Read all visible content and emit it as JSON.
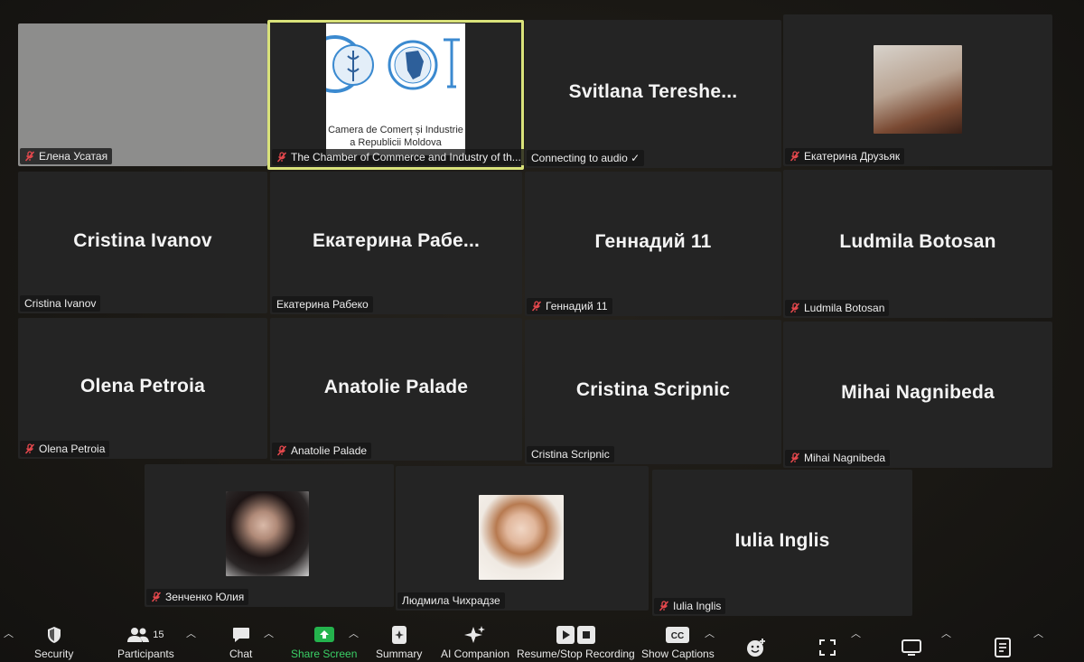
{
  "tiles": [
    {
      "id": "t1",
      "label": "Елена Усатая",
      "muted": true
    },
    {
      "id": "t2",
      "label": "The Chamber of Commerce and Industry of th...",
      "muted": true,
      "logo_text_1": "Camera de Comerț și Industrie",
      "logo_text_2": "a Republicii Moldova"
    },
    {
      "id": "t3",
      "center": "Svitlana  Tereshe...",
      "label": "Connecting to audio ✓",
      "muted": false
    },
    {
      "id": "t4",
      "label": "Екатерина Друзьяк",
      "muted": true
    },
    {
      "id": "t5",
      "center": "Cristina Ivanov",
      "label": "Cristina Ivanov",
      "muted": false
    },
    {
      "id": "t6",
      "center": "Екатерина  Рабе...",
      "label": "Екатерина Рабеко",
      "muted": false
    },
    {
      "id": "t7",
      "center": "Геннадий 11",
      "label": "Геннадий 11",
      "muted": true
    },
    {
      "id": "t8",
      "center": "Ludmila Botosan",
      "label": "Ludmila Botosan",
      "muted": true
    },
    {
      "id": "t9",
      "center": "Olena Petroia",
      "label": "Olena Petroia",
      "muted": true
    },
    {
      "id": "t10",
      "center": "Anatolie Palade",
      "label": "Anatolie Palade",
      "muted": true
    },
    {
      "id": "t11",
      "center": "Cristina Scripnic",
      "label": "Cristina Scripnic",
      "muted": false
    },
    {
      "id": "t12",
      "center": "Mihai Nagnibeda",
      "label": "Mihai Nagnibeda",
      "muted": true
    },
    {
      "id": "t13",
      "label": "Зенченко Юлия",
      "muted": true
    },
    {
      "id": "t14",
      "label": "Людмила Чихрадзе",
      "muted": false
    },
    {
      "id": "t15",
      "center": "Iulia Inglis",
      "label": "Iulia Inglis",
      "muted": true
    }
  ],
  "toolbar": {
    "security": "Security",
    "participants": "Participants",
    "participants_count": "15",
    "chat": "Chat",
    "share_screen": "Share Screen",
    "summary": "Summary",
    "ai_companion": "AI Companion",
    "recording": "Resume/Stop Recording",
    "captions": "Show Captions",
    "cc": "CC"
  },
  "colors": {
    "share_green": "#24b34d",
    "active_border": "#d9e27a",
    "mute_red": "#e5484d"
  }
}
